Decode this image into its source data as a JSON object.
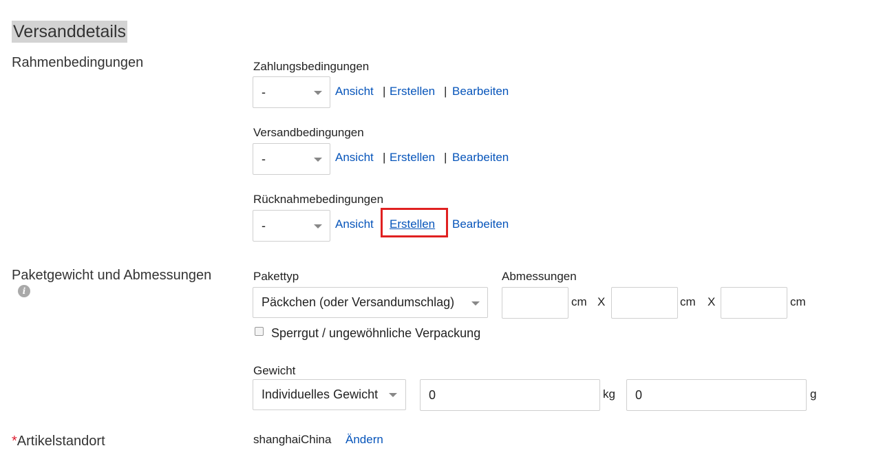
{
  "section": {
    "title": "Versanddetails"
  },
  "rahmen": {
    "label": "Rahmenbedingungen",
    "policies": [
      {
        "name": "Zahlungsbedingungen",
        "value": "-",
        "links": [
          "Ansicht",
          "Erstellen",
          "Bearbeiten"
        ]
      },
      {
        "name": "Versandbedingungen",
        "value": "-",
        "links": [
          "Ansicht",
          "Erstellen",
          "Bearbeiten"
        ]
      },
      {
        "name": "Rücknahmebedingungen",
        "value": "-",
        "links": [
          "Ansicht",
          "Erstellen",
          "Bearbeiten"
        ]
      }
    ],
    "separator": "|"
  },
  "paket": {
    "label": "Paketgewicht und Abmessungen",
    "info_icon": "info-icon",
    "pakettyp_label": "Pakettyp",
    "pakettyp_value": "Päckchen (oder Versandumschlag)",
    "abmessungen_label": "Abmessungen",
    "dim_unit": "cm",
    "dim_sep": "X",
    "dims": [
      "",
      "",
      ""
    ],
    "sperrgut_label": "Sperrgut / ungewöhnliche Verpackung",
    "sperrgut_checked": false,
    "gewicht_label": "Gewicht",
    "gewicht_type": "Individuelles Gewicht",
    "kg_value": "0",
    "kg_unit": "kg",
    "g_value": "0",
    "g_unit": "g"
  },
  "standort": {
    "required_mark": "*",
    "label": "Artikelstandort",
    "value": "shanghaiChina",
    "change_link": "Ändern"
  },
  "colors": {
    "link": "#0654ba",
    "highlight": "#e02020",
    "required": "#dd1e31"
  }
}
